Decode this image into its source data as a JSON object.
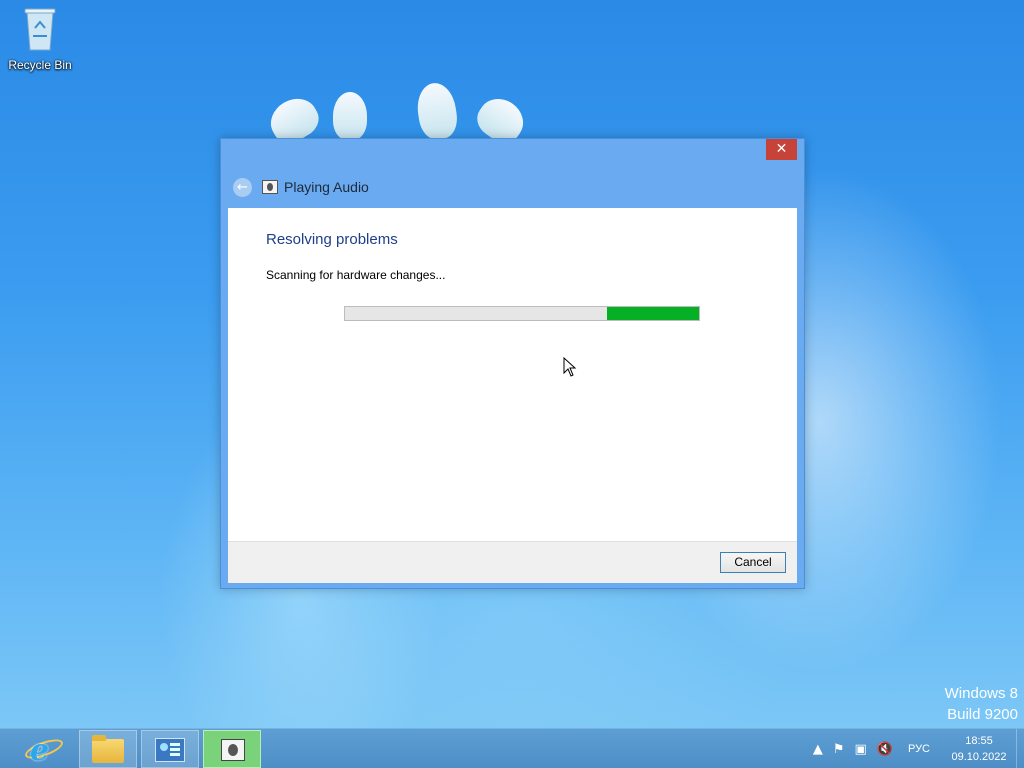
{
  "desktop": {
    "icons": [
      {
        "label": "Recycle Bin",
        "icon": "recycle-bin-icon"
      }
    ],
    "watermark": {
      "line1": "Windows 8",
      "line2": "Build 9200"
    }
  },
  "window": {
    "title": "Playing Audio",
    "close_label": "✕",
    "back_icon": "back-arrow-icon",
    "app_icon": "audio-troubleshooter-icon",
    "heading": "Resolving problems",
    "status": "Scanning for hardware changes...",
    "progress": {
      "fill_start": 0.74,
      "fill_end": 1.0,
      "mode": "marquee",
      "color": "#06b025"
    },
    "cancel_label": "Cancel"
  },
  "taskbar": {
    "pinned": [
      {
        "name": "internet-explorer",
        "icon": "ie-icon"
      },
      {
        "name": "file-explorer",
        "icon": "folder-icon"
      },
      {
        "name": "control-panel",
        "icon": "control-panel-icon"
      },
      {
        "name": "playing-audio",
        "icon": "audio-troubleshooter-icon",
        "active": true
      }
    ],
    "tray": {
      "language": "РУС",
      "time": "18:55",
      "date": "09.10.2022"
    }
  }
}
